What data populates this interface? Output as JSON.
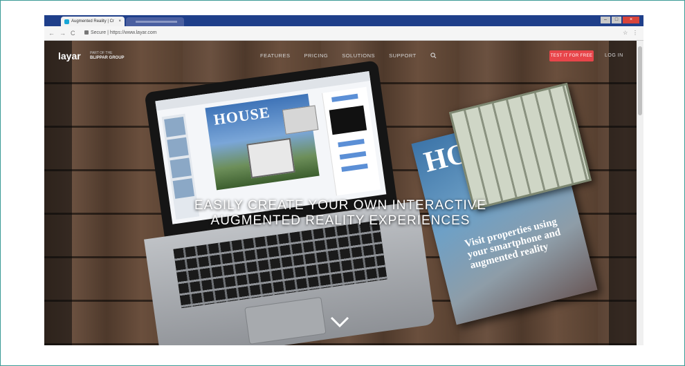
{
  "browser": {
    "tab_title": "Augmented Reality | Cre",
    "tab_close": "×",
    "url_secure_label": "Secure",
    "url_text": "https://www.layar.com",
    "omnibox_display": "Secure | https://www.layar.com",
    "nav_back": "←",
    "nav_forward": "→",
    "nav_reload": "C",
    "star": "☆",
    "menu_dots": "⋮",
    "minimize": "–",
    "maximize": "□",
    "close": "×"
  },
  "site": {
    "logo": "layar",
    "logo_tagline_top": "PART OF THE",
    "logo_tagline_bottom": "BLIPPAR GROUP",
    "nav": [
      "FEATURES",
      "PRICING",
      "SOLUTIONS",
      "SUPPORT"
    ],
    "search_icon": "search-icon",
    "signup": "TEST IT FOR FREE",
    "login": "LOG IN",
    "hero_line1": "EASILY CREATE YOUR OWN INTERACTIVE",
    "hero_line2": "AUGMENTED REALITY EXPERIENCES",
    "laptop_screen_word": "HOUSE",
    "magazine_title": "HO",
    "magazine_text": "Visit properties using your smartphone and augmented reality",
    "scroll_down_icon": "chevron-down-icon"
  },
  "colors": {
    "frame_border": "#3a9a95",
    "tabstrip": "#1f3f8a",
    "signup_bg": "#e8454a"
  }
}
